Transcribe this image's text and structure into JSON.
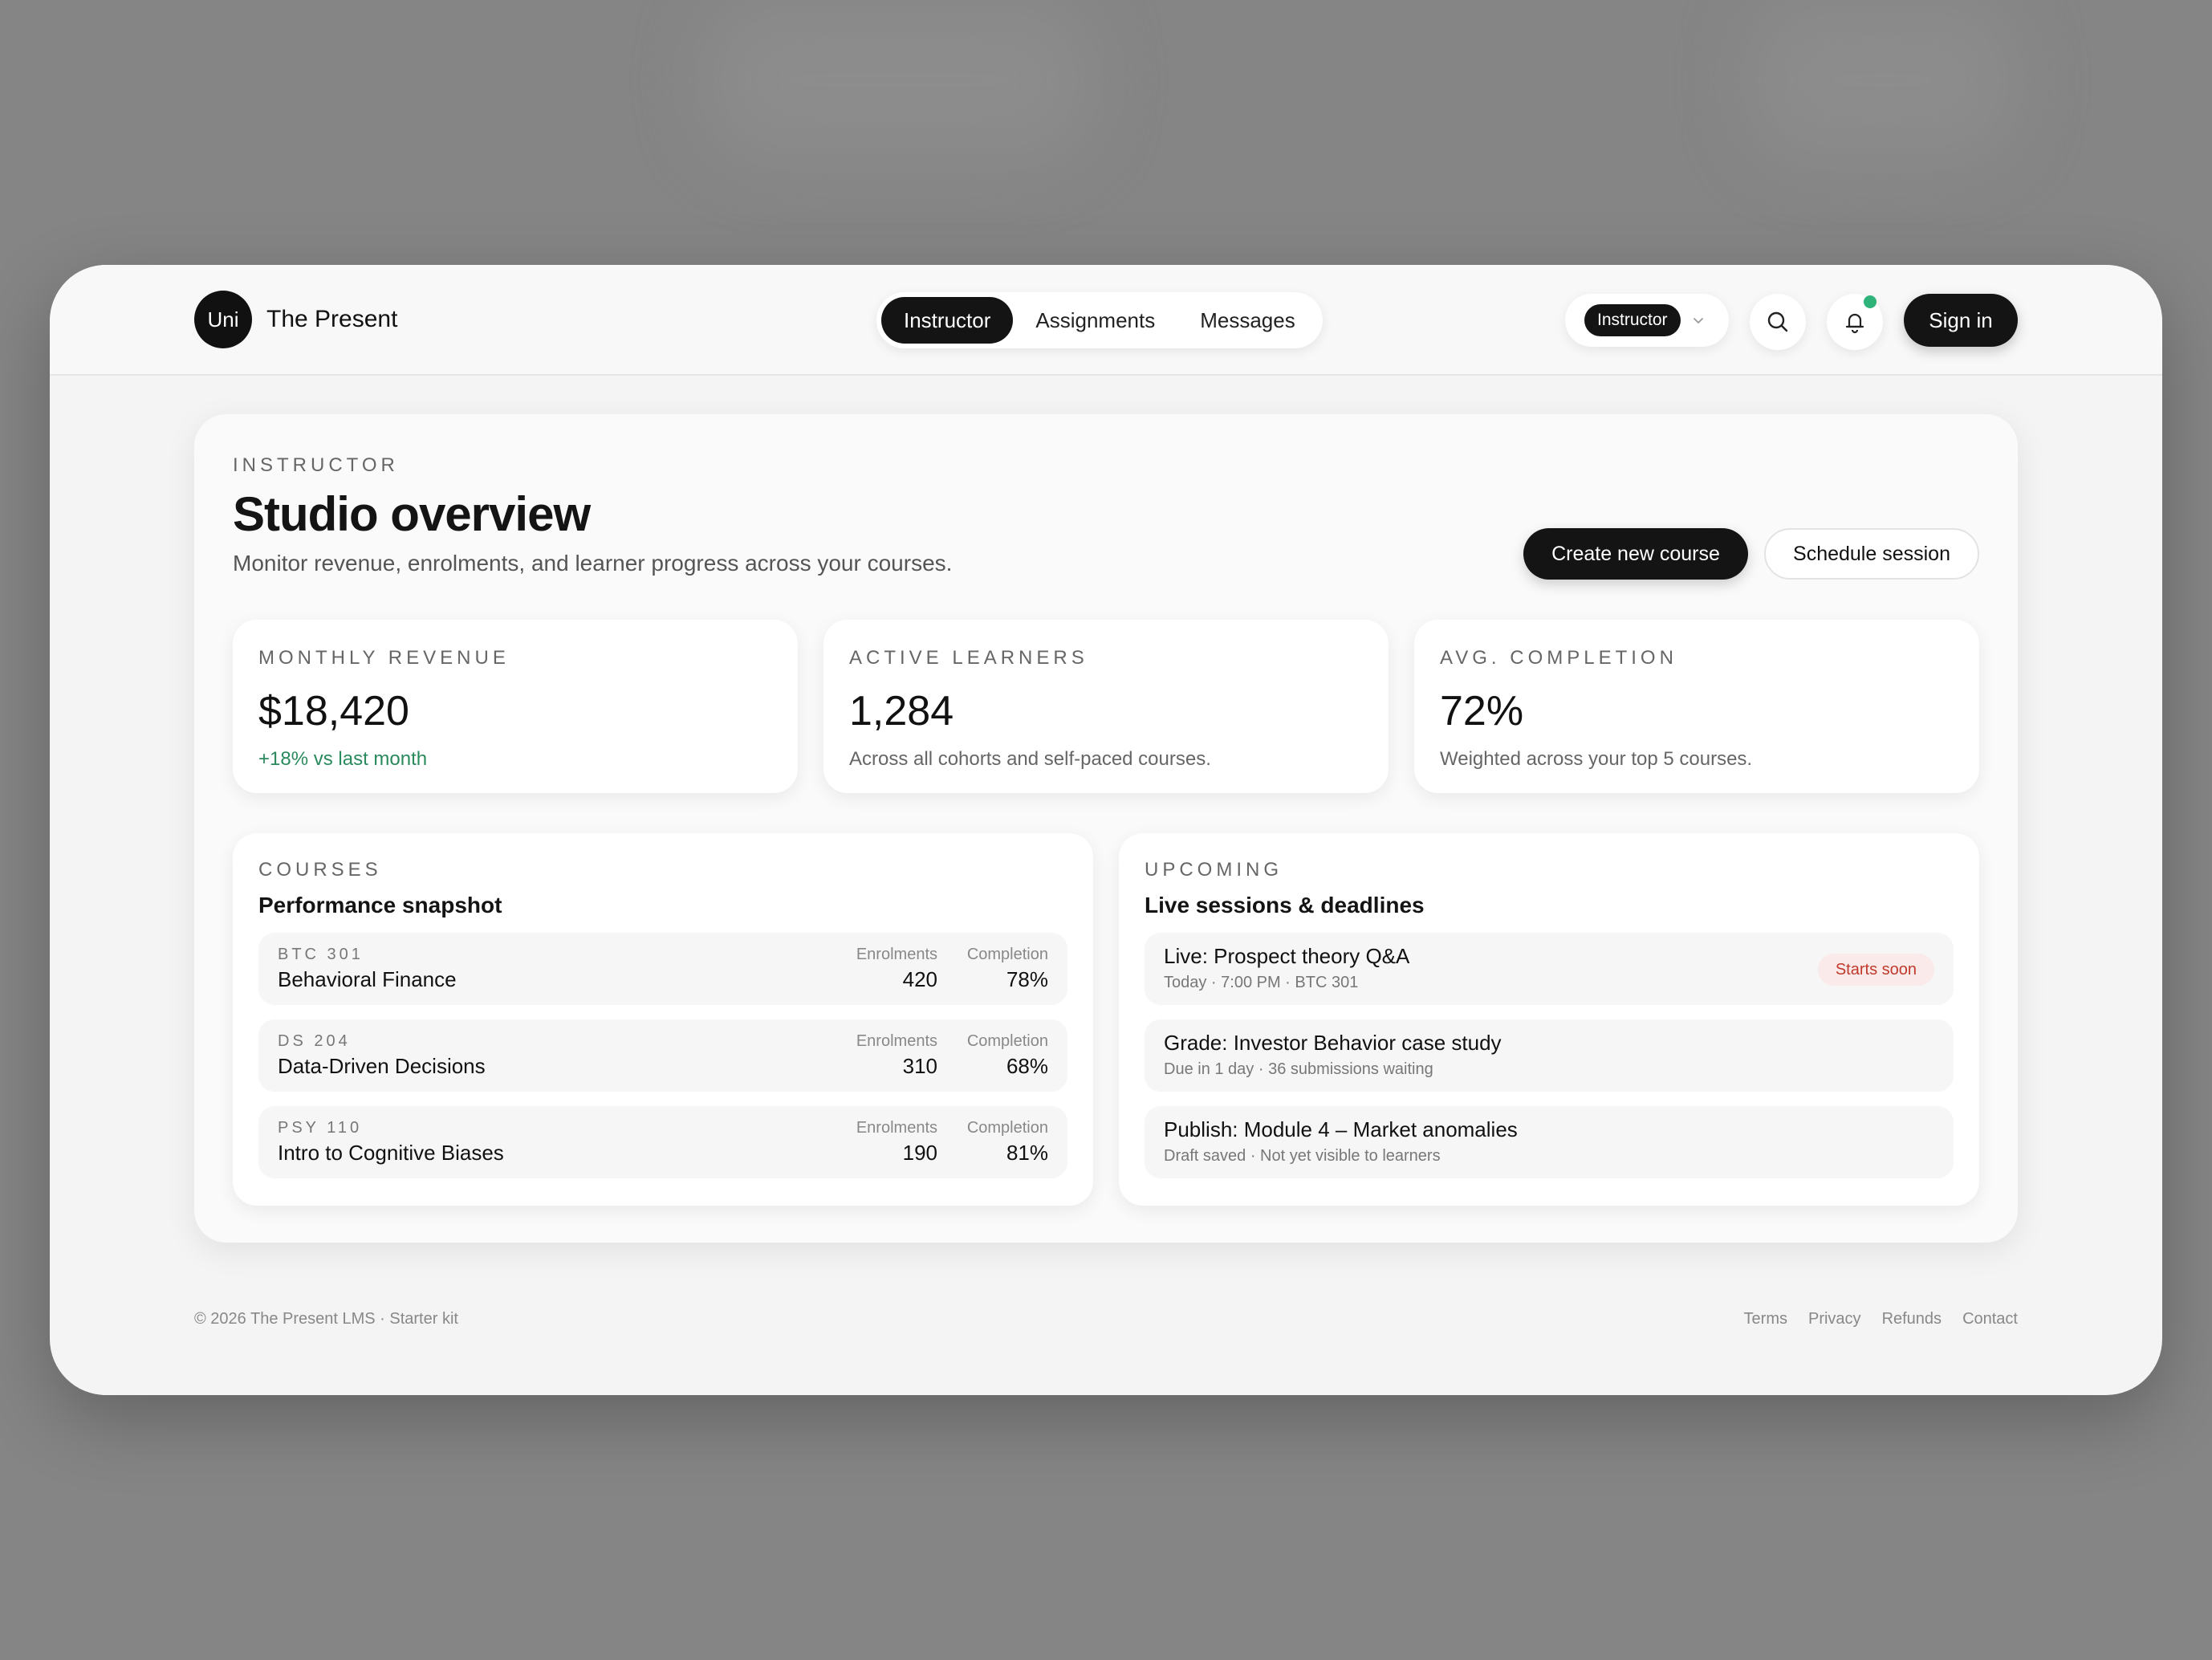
{
  "brand": {
    "logo_text": "Uni",
    "name": "The Present"
  },
  "nav": {
    "tabs": [
      {
        "label": "Instructor"
      },
      {
        "label": "Assignments"
      },
      {
        "label": "Messages"
      }
    ]
  },
  "header": {
    "role": "Instructor",
    "sign_in": "Sign in"
  },
  "page": {
    "eyebrow": "INSTRUCTOR",
    "title": "Studio overview",
    "subtitle": "Monitor revenue, enrolments, and learner progress across your courses.",
    "primary_action": "Create new course",
    "secondary_action": "Schedule session"
  },
  "stats": [
    {
      "label": "MONTHLY REVENUE",
      "value": "$18,420",
      "note": "+18% vs last month"
    },
    {
      "label": "ACTIVE LEARNERS",
      "value": "1,284",
      "note": "Across all cohorts and self-paced courses."
    },
    {
      "label": "AVG. COMPLETION",
      "value": "72%",
      "note": "Weighted across your top 5 courses."
    }
  ],
  "courses": {
    "eyebrow": "COURSES",
    "title": "Performance snapshot",
    "enrol_label": "Enrolments",
    "completion_label": "Completion",
    "rows": [
      {
        "code": "BTC 301",
        "name": "Behavioral Finance",
        "enrolments": "420",
        "completion": "78%"
      },
      {
        "code": "DS 204",
        "name": "Data-Driven Decisions",
        "enrolments": "310",
        "completion": "68%"
      },
      {
        "code": "PSY 110",
        "name": "Intro to Cognitive Biases",
        "enrolments": "190",
        "completion": "81%"
      }
    ]
  },
  "upcoming": {
    "eyebrow": "UPCOMING",
    "title": "Live sessions & deadlines",
    "rows": [
      {
        "title": "Live: Prospect theory Q&A",
        "meta": "Today · 7:00 PM · BTC 301",
        "badge": "Starts soon"
      },
      {
        "title": "Grade: Investor Behavior case study",
        "meta": "Due in 1 day · 36 submissions waiting"
      },
      {
        "title": "Publish: Module 4 – Market anomalies",
        "meta": "Draft saved · Not yet visible to learners"
      }
    ]
  },
  "footer": {
    "copyright": "© 2026 The Present LMS · Starter kit",
    "links": [
      {
        "label": "Terms"
      },
      {
        "label": "Privacy"
      },
      {
        "label": "Refunds"
      },
      {
        "label": "Contact"
      }
    ]
  },
  "colors": {
    "accent": "#141414",
    "positive": "#2a8a5d",
    "badge_text": "#c0392b",
    "notification": "#2fb37a"
  }
}
